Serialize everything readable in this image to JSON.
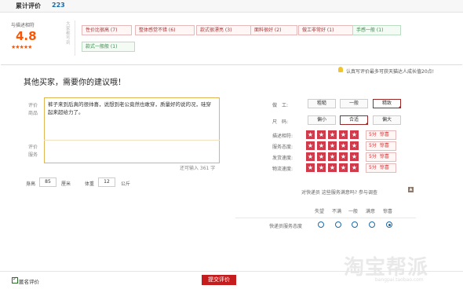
{
  "header": {
    "tab_label": "累计评价",
    "tab_count": "223"
  },
  "summary": {
    "score_label": "与描述相符",
    "score": "4.8",
    "stars": "★★★★★",
    "side_note": "大家都写到",
    "tags": [
      {
        "text": "性价比很高 (7)",
        "type": "red"
      },
      {
        "text": "整体感觉不错 (6)",
        "type": "red"
      },
      {
        "text": "款式很漂亮 (3)",
        "type": "red"
      },
      {
        "text": "面料很好 (2)",
        "type": "red"
      },
      {
        "text": "做工非常好 (1)",
        "type": "red"
      },
      {
        "text": "手感一般 (1)",
        "type": "green"
      },
      {
        "text": "款式一般般 (1)",
        "type": "green"
      }
    ]
  },
  "form": {
    "tip": "认真写评价最多可获天猫达人成长值20点!",
    "title": "其他买家，需要你的建议哦！",
    "eval_product_label": "评价商品",
    "review_text": "裤子来到后真的很帅喜，说想到老公竟然也敢穿，质量好的说的况，硅穿起来超给力了。",
    "eval_service_label": "评价服务",
    "remaining": "还可输入 361 字",
    "height_label": "身高",
    "height_value": "85",
    "height_unit": "厘米",
    "weight_label": "体重",
    "weight_value": "12",
    "weight_unit": "公斤",
    "craft_label": "做　工:",
    "craft_options": [
      {
        "label": "粗糙",
        "selected": false
      },
      {
        "label": "一般",
        "selected": false
      },
      {
        "label": "精致",
        "selected": true
      }
    ],
    "size_label": "尺　码:",
    "size_options": [
      {
        "label": "偏小",
        "selected": false
      },
      {
        "label": "合适",
        "selected": true
      },
      {
        "label": "偏大",
        "selected": false
      }
    ],
    "ratings": [
      {
        "label": "描述相符:",
        "stars": 5,
        "score": "5分",
        "comment": "惊喜"
      },
      {
        "label": "服务态度:",
        "stars": 5,
        "score": "5分",
        "comment": "惊喜"
      },
      {
        "label": "发货速度:",
        "stars": 5,
        "score": "5分",
        "comment": "惊喜"
      },
      {
        "label": "物流速度:",
        "stars": 5,
        "score": "5分",
        "comment": "惊喜"
      }
    ],
    "courier_prompt": "对快递员  这些服务满意吗? 参与调查",
    "courier_columns": [
      "失望",
      "不满",
      "一般",
      "满意",
      "惊喜"
    ],
    "courier_row_label": "快递员服务态度",
    "courier_selected_index": 4,
    "anonymous_label": "匿名评价",
    "anonymous_checked": true,
    "submit_label": "提交评价"
  },
  "watermark": {
    "main": "淘宝帮派",
    "sub": "bangpai.taobao.com"
  },
  "colors": {
    "accent": "#c51d1d",
    "score": "#ff5500",
    "link": "#1c6aa6"
  }
}
